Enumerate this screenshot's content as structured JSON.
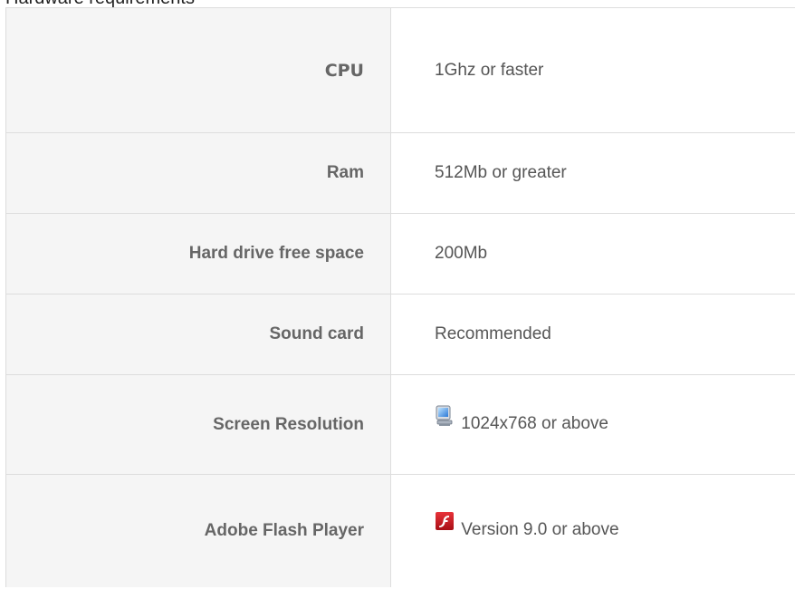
{
  "heading": "Hardware requirements",
  "requirements": [
    {
      "label": "CPU",
      "value": "1Ghz or faster"
    },
    {
      "label": "Ram",
      "value": "512Mb or greater"
    },
    {
      "label": "Hard drive free space",
      "value": "200Mb"
    },
    {
      "label": "Sound card",
      "value": "Recommended"
    },
    {
      "label": "Screen Resolution",
      "value": "1024x768 or above",
      "icon": "monitor-icon"
    },
    {
      "label": "Adobe Flash Player",
      "value": "Version 9.0 or above",
      "icon": "flash-player-icon"
    }
  ],
  "colors": {
    "label_background": "#f5f5f5",
    "border": "#dddddd",
    "label_text": "#666666",
    "value_text": "#555555",
    "flash_red": "#c8161d"
  }
}
